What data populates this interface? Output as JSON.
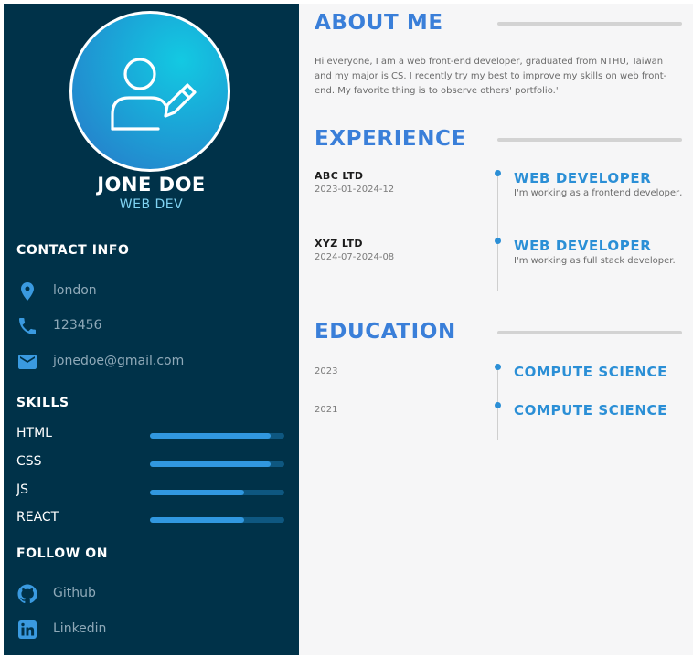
{
  "profile": {
    "name": "JONE DOE",
    "role": "WEB DEV",
    "avatar_icon": "user-edit-icon"
  },
  "contact": {
    "title": "CONTACT INFO",
    "items": [
      {
        "icon": "location-pin-icon",
        "text": "london"
      },
      {
        "icon": "phone-icon",
        "text": "123456"
      },
      {
        "icon": "mail-icon",
        "text": "jonedoe@gmail.com"
      }
    ]
  },
  "skills": {
    "title": "SKILLS",
    "items": [
      {
        "label": "HTML",
        "level": 0.9
      },
      {
        "label": "CSS",
        "level": 0.9
      },
      {
        "label": "JS",
        "level": 0.7
      },
      {
        "label": "REACT",
        "level": 0.7
      }
    ]
  },
  "follow": {
    "title": "FOLLOW ON",
    "items": [
      {
        "icon": "github-icon",
        "text": "Github"
      },
      {
        "icon": "linkedin-icon",
        "text": "Linkedin"
      }
    ]
  },
  "about": {
    "title": "ABOUT ME",
    "text": "Hi everyone, I am a web front-end developer, graduated from NTHU, Taiwan and my major is CS. I recently try my best to improve my skills on web front-end. My favorite thing is to observe others' portfolio.'"
  },
  "experience": {
    "title": "EXPERIENCE",
    "items": [
      {
        "company": "ABC LTD",
        "dates": "2023-01-2024-12",
        "title": "WEB DEVELOPER",
        "desc": "I'm working as a frontend developer,"
      },
      {
        "company": "XYZ LTD",
        "dates": "2024-07-2024-08",
        "title": "WEB DEVELOPER",
        "desc": "I'm working as full stack developer."
      }
    ]
  },
  "education": {
    "title": "EDUCATION",
    "items": [
      {
        "year": "2023",
        "title": "COMPUTE SCIENCE"
      },
      {
        "year": "2021",
        "title": "COMPUTE SCIENCE"
      }
    ]
  },
  "colors": {
    "sidebar_bg": "#003249",
    "accent": "#3a7fd9",
    "timeline_accent": "#2b8fd6",
    "skill_fill": "#3198e0",
    "skill_track": "#0e5780",
    "icon_blue": "#3a9ae0"
  }
}
